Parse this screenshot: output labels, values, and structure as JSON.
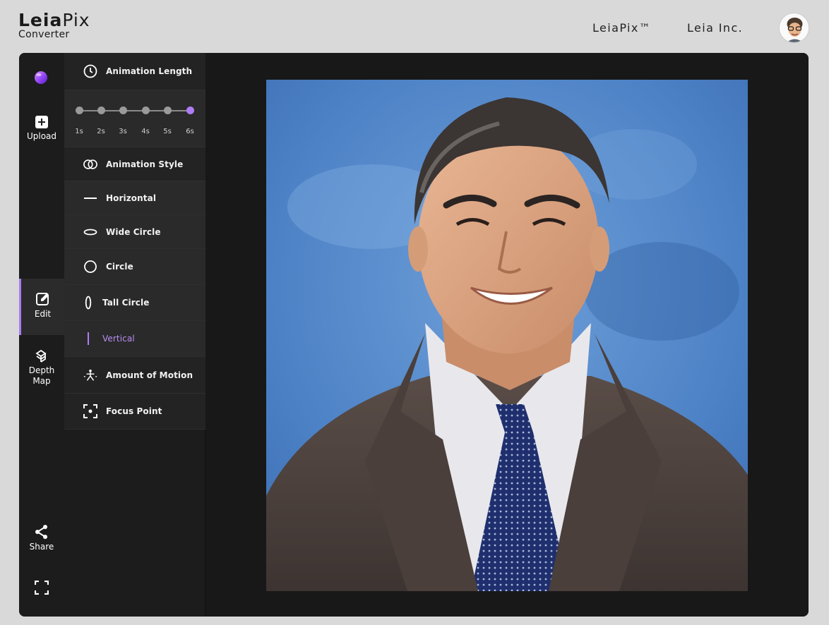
{
  "header": {
    "logo_bold": "Leia",
    "logo_light": "Pix",
    "logo_sub": "Converter",
    "nav": [
      "LeiaPix™",
      "Leia Inc."
    ]
  },
  "rail": {
    "upload": "Upload",
    "edit": "Edit",
    "depth_map": [
      "Depth",
      "Map"
    ],
    "share": "Share"
  },
  "panel": {
    "animation_length": "Animation Length",
    "durations": [
      "1s",
      "2s",
      "3s",
      "4s",
      "5s",
      "6s"
    ],
    "selected_duration": "6s",
    "animation_style": "Animation Style",
    "styles": [
      "Horizontal",
      "Wide Circle",
      "Circle",
      "Tall Circle",
      "Vertical"
    ],
    "selected_style": "Vertical",
    "amount_of_motion": "Amount of Motion",
    "focus_point": "Focus Point"
  },
  "colors": {
    "accent": "#b07cf5",
    "app_bg": "#181818",
    "page_bg": "#d9d9d9"
  }
}
